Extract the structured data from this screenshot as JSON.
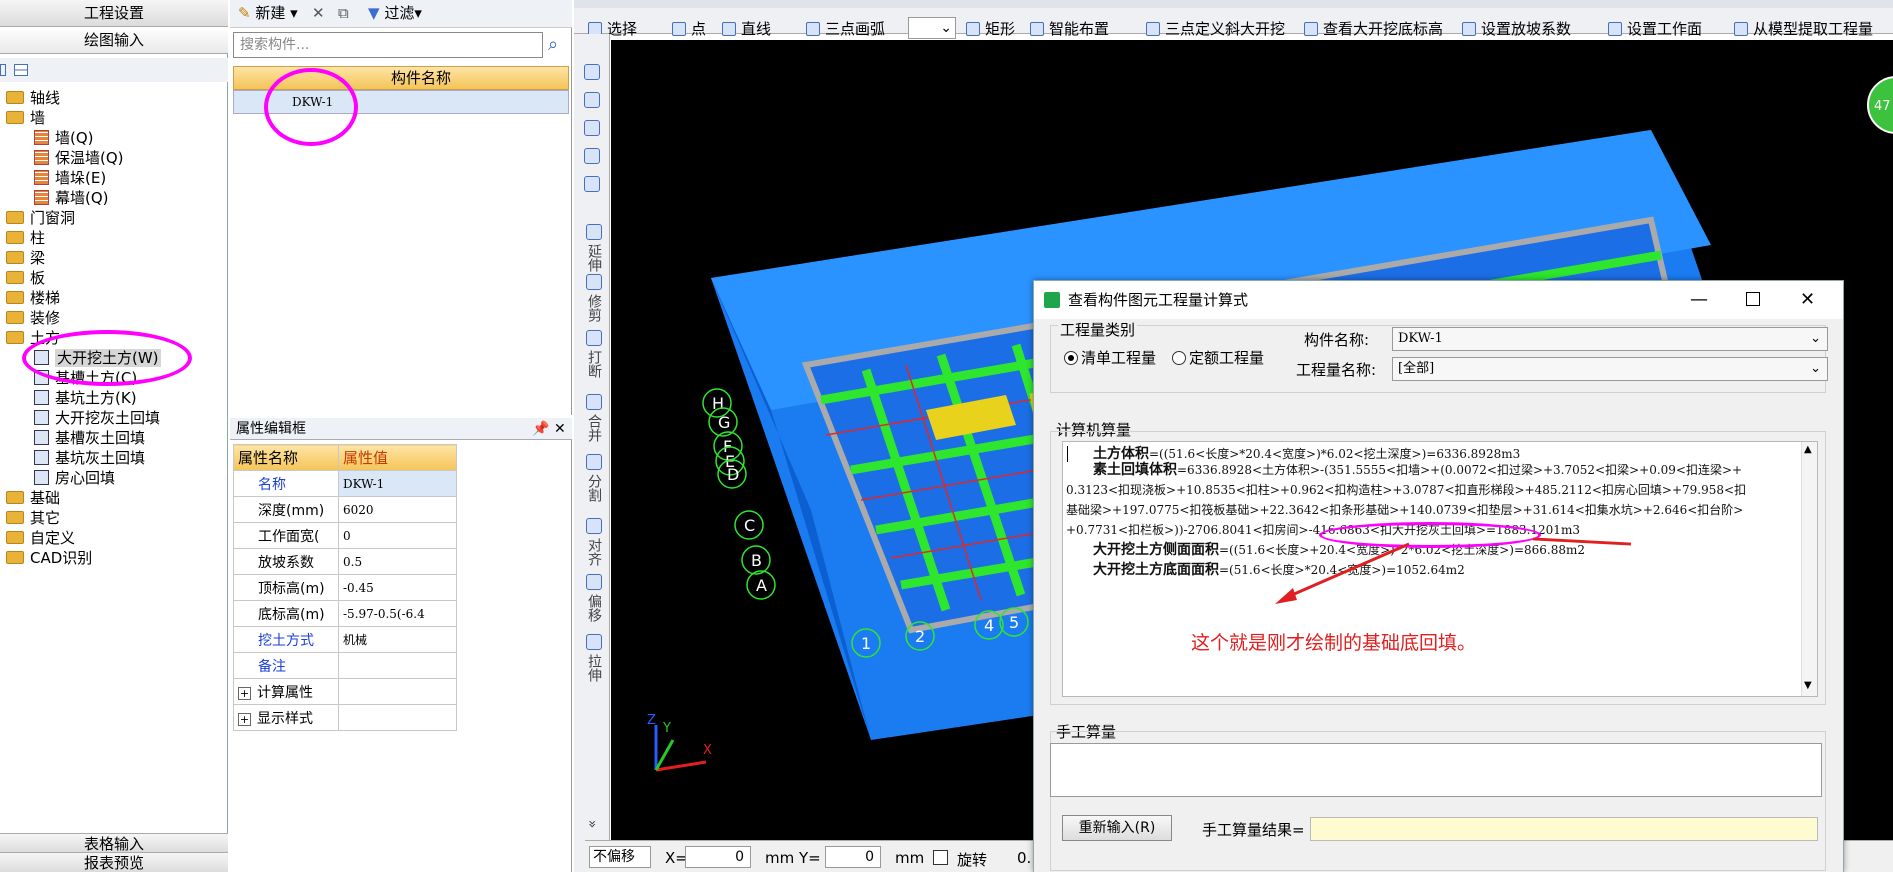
{
  "leftnav": {
    "top_buttons": [
      "工程设置",
      "绘图输入"
    ],
    "bottom_buttons": [
      "表格输入",
      "报表预览"
    ],
    "tree": [
      {
        "label": "轴线",
        "indent": 0,
        "kind": "folder"
      },
      {
        "label": "墙",
        "indent": 0,
        "kind": "folder"
      },
      {
        "label": "墙(Q)",
        "indent": 1,
        "kind": "brick"
      },
      {
        "label": "保温墙(Q)",
        "indent": 1,
        "kind": "brick"
      },
      {
        "label": "墙垛(E)",
        "indent": 1,
        "kind": "brick"
      },
      {
        "label": "幕墙(Q)",
        "indent": 1,
        "kind": "brick"
      },
      {
        "label": "门窗洞",
        "indent": 0,
        "kind": "folder"
      },
      {
        "label": "柱",
        "indent": 0,
        "kind": "folder"
      },
      {
        "label": "梁",
        "indent": 0,
        "kind": "folder"
      },
      {
        "label": "板",
        "indent": 0,
        "kind": "folder"
      },
      {
        "label": "楼梯",
        "indent": 0,
        "kind": "folder"
      },
      {
        "label": "装修",
        "indent": 0,
        "kind": "folder"
      },
      {
        "label": "土方",
        "indent": 0,
        "kind": "folder"
      },
      {
        "label": "大开挖土方(W)",
        "indent": 1,
        "kind": "box",
        "selected": true
      },
      {
        "label": "基槽土方(C)",
        "indent": 1,
        "kind": "box"
      },
      {
        "label": "基坑土方(K)",
        "indent": 1,
        "kind": "box"
      },
      {
        "label": "大开挖灰土回填",
        "indent": 1,
        "kind": "box"
      },
      {
        "label": "基槽灰土回填",
        "indent": 1,
        "kind": "box"
      },
      {
        "label": "基坑灰土回填",
        "indent": 1,
        "kind": "box"
      },
      {
        "label": "房心回填",
        "indent": 1,
        "kind": "box"
      },
      {
        "label": "基础",
        "indent": 0,
        "kind": "folder"
      },
      {
        "label": "其它",
        "indent": 0,
        "kind": "folder"
      },
      {
        "label": "自定义",
        "indent": 0,
        "kind": "folder"
      },
      {
        "label": "CAD识别",
        "indent": 0,
        "kind": "folder"
      }
    ]
  },
  "component_panel": {
    "toolbar": {
      "new": "新建",
      "filter": "过滤"
    },
    "search_placeholder": "搜索构件...",
    "column_header": "构件名称",
    "rows": [
      "DKW-1"
    ]
  },
  "property_panel": {
    "title": "属性编辑框",
    "col_name": "属性名称",
    "col_value": "属性值",
    "rows": [
      {
        "name": "名称",
        "value": "DKW-1",
        "blue": true
      },
      {
        "name": "深度(mm)",
        "value": "6020",
        "blue": false
      },
      {
        "name": "工作面宽(",
        "value": "0",
        "blue": false
      },
      {
        "name": "放坡系数",
        "value": "0.5",
        "blue": false
      },
      {
        "name": "顶标高(m)",
        "value": "-0.45",
        "blue": false
      },
      {
        "name": "底标高(m)",
        "value": "-5.97-0.5(-6.4",
        "blue": false
      },
      {
        "name": "挖土方式",
        "value": "机械",
        "blue": true
      },
      {
        "name": "备注",
        "value": "",
        "blue": true
      }
    ],
    "groups": [
      "计算属性",
      "显示样式"
    ]
  },
  "top_toolbar": {
    "items": [
      "选择",
      "点",
      "直线",
      "三点画弧",
      "矩形",
      "智能布置",
      "三点定义斜大开挖",
      "查看大开挖底标高",
      "设置放坡系数",
      "设置工作面",
      "从模型提取工程量"
    ]
  },
  "vertical_toolbar": {
    "items": [
      "延伸",
      "修剪",
      "打断",
      "合并",
      "分割",
      "对齐",
      "偏移",
      "拉伸"
    ]
  },
  "canvas": {
    "axis_left": [
      "H",
      "G",
      "F",
      "E",
      "D",
      "C",
      "B",
      "A"
    ],
    "axis_bottom": [
      "1",
      "2",
      "4",
      "5"
    ],
    "corner_badge": "47"
  },
  "status_bar": {
    "snap": "不偏移",
    "x_label": "X=",
    "x_value": "0",
    "y_label": "mm Y=",
    "y_value": "0",
    "unit": "mm",
    "rotate": "旋转",
    "rotate_value": "0."
  },
  "dialog": {
    "title": "查看构件图元工程量计算式",
    "category_label": "工程量类别",
    "radio_list": "清单工程量",
    "radio_quota": "定额工程量",
    "component_name_label": "构件名称:",
    "component_name_value": "DKW-1",
    "quantity_name_label": "工程量名称:",
    "quantity_name_value": "[全部]",
    "calc_label": "计算机算量",
    "calc_lines": [
      {
        "key": "土方体积",
        "text": "=((51.6<长度>*20.4<宽度>)*6.02<挖土深度>)=6336.8928m3"
      },
      {
        "key": "素土回填体积",
        "text": "=6336.8928<土方体积>-(351.5555<扣墙>+(0.0072<扣过梁>+3.7052<扣梁>+0.09<扣连梁>+"
      },
      {
        "key": "",
        "text": "0.3123<扣现浇板>+10.8535<扣柱>+0.962<扣构造柱>+3.0787<扣直形梯段>+485.2112<扣房心回填>+79.958<扣"
      },
      {
        "key": "",
        "text": "基础梁>+197.0775<扣筏板基础>+22.3642<扣条形基础>+140.0739<扣垫层>+31.614<扣集水坑>+2.646<扣台阶>"
      },
      {
        "key": "",
        "text": "+0.7731<扣栏板>))-2706.8041<扣房间>-416.6863<扣大开挖灰土回填>=1883.1201m3"
      },
      {
        "key": "大开挖土方侧面面积",
        "text": "=((51.6<长度>+20.4<宽度>)*2*6.02<挖土深度>)=866.88m2"
      },
      {
        "key": "大开挖土方底面面积",
        "text": "=(51.6<长度>*20.4<宽度>)=1052.64m2"
      }
    ],
    "annotation": "这个就是刚才绘制的基础底回填。",
    "manual_label": "手工算量",
    "reenter_button": "重新输入(R)",
    "manual_result_label": "手工算量结果="
  },
  "colors": {
    "accent_magenta": "#ff00ff",
    "annotation_red": "#e02020",
    "pit_blue": "#1577f0",
    "header_orange": "#f5c458"
  }
}
